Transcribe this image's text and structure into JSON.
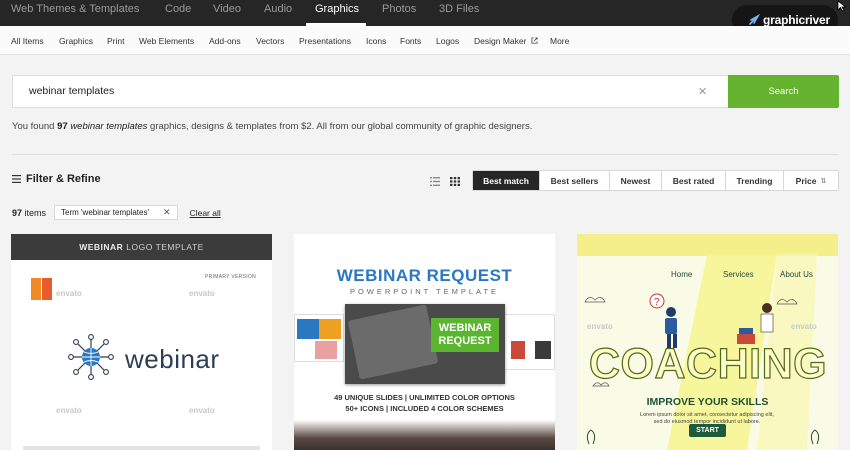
{
  "topnav": {
    "tabs": [
      {
        "label": "Web Themes & Templates"
      },
      {
        "label": "Code"
      },
      {
        "label": "Video"
      },
      {
        "label": "Audio"
      },
      {
        "label": "Graphics"
      },
      {
        "label": "Photos"
      },
      {
        "label": "3D Files"
      }
    ],
    "active_tab": "Graphics",
    "brand": "graphicriver"
  },
  "subnav": {
    "items": [
      {
        "label": "All Items"
      },
      {
        "label": "Graphics"
      },
      {
        "label": "Print"
      },
      {
        "label": "Web Elements"
      },
      {
        "label": "Add-ons"
      },
      {
        "label": "Vectors"
      },
      {
        "label": "Presentations"
      },
      {
        "label": "Icons"
      },
      {
        "label": "Fonts"
      },
      {
        "label": "Logos"
      },
      {
        "label": "Design Maker"
      },
      {
        "label": "More"
      }
    ]
  },
  "search": {
    "value": "webinar templates",
    "button_label": "Search"
  },
  "results": {
    "prefix": "You found ",
    "count": "97",
    "query": "webinar templates",
    "suffix": " graphics, designs & templates from $2. All from our global community of graphic designers."
  },
  "filter": {
    "label": "Filter & Refine",
    "items_count": "97",
    "items_word": " items",
    "term_chip": "Term 'webinar templates'",
    "clear_all": "Clear all"
  },
  "sort": {
    "options": [
      {
        "label": "Best match"
      },
      {
        "label": "Best sellers"
      },
      {
        "label": "Newest"
      },
      {
        "label": "Best rated"
      },
      {
        "label": "Trending"
      },
      {
        "label": "Price"
      }
    ],
    "active": "Best match"
  },
  "cards": {
    "card1": {
      "header_bold": "WEBINAR",
      "header_light": "LOGO TEMPLATE",
      "primary_version": "PRIMARY VERSION",
      "logo_word": "webinar",
      "watermark": "envato"
    },
    "card2": {
      "title": "WEBINAR REQUEST",
      "subtitle": "POWERPOINT TEMPLATE",
      "badge_line1": "WEBINAR",
      "badge_line2": "REQUEST",
      "features_line1": "49 UNIQUE SLIDES | UNLIMITED COLOR OPTIONS",
      "features_line2": "50+ ICONS | INCLUDED 4 COLOR SCHEMES"
    },
    "card3": {
      "nav": [
        {
          "label": "Home"
        },
        {
          "label": "Services"
        },
        {
          "label": "About Us"
        }
      ],
      "title": "COACHING",
      "subtitle": "IMPROVE YOUR SKILLS",
      "lorem": "Lorem ipsum dolor sit amet, consectetur adipiscing elit, sed do eiusmod tempor incididunt ut labore.",
      "cta": "START",
      "watermark": "envato"
    }
  },
  "colors": {
    "accent_green": "#65b32e",
    "topbar": "#262626",
    "active_sort": "#262626"
  }
}
